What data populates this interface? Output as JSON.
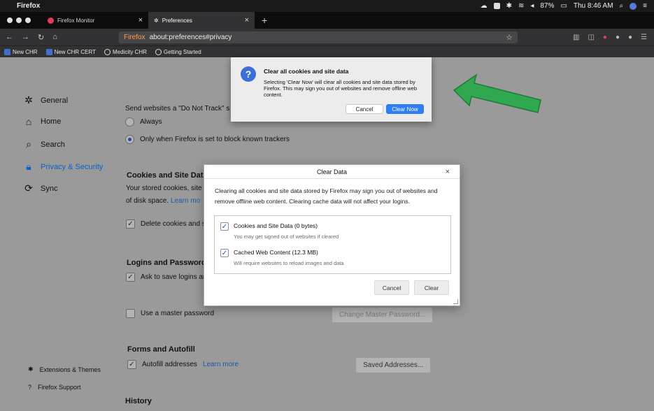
{
  "menubar": {
    "app_name": "Firefox",
    "battery": "87%",
    "clock": "Thu 8:46 AM"
  },
  "tabs": [
    {
      "label": "Firefox Monitor",
      "close": "×"
    },
    {
      "label": "Preferences",
      "close": "×"
    }
  ],
  "newtab": "+",
  "navbar": {
    "identity": "Firefox",
    "url": "about:preferences#privacy"
  },
  "bookmarks": [
    "New CHR",
    "New CHR CERT",
    "Medicity CHR",
    "Getting Started"
  ],
  "sidebar": {
    "items": [
      {
        "label": "General",
        "icon": "gear-icon"
      },
      {
        "label": "Home",
        "icon": "home-icon"
      },
      {
        "label": "Search",
        "icon": "search-icon"
      },
      {
        "label": "Privacy & Security",
        "icon": "lock-icon"
      },
      {
        "label": "Sync",
        "icon": "sync-icon"
      }
    ],
    "bottom": [
      {
        "label": "Extensions & Themes",
        "icon": "puzzle-icon"
      },
      {
        "label": "Firefox Support",
        "icon": "help-icon"
      }
    ]
  },
  "prefs": {
    "dnt_text": "Send websites a \"Do Not Track\" s",
    "dnt_always": "Always",
    "dnt_only": "Only when Firefox is set to block known trackers",
    "cookies_heading": "Cookies and Site Dat",
    "cookies_text_1": "Your stored cookies, site",
    "cookies_text_2": "of disk space.",
    "cookies_learn": "Learn mo",
    "delete_cookies": "Delete cookies and s",
    "logins_heading": "Logins and Password",
    "ask_save": "Ask to save logins ar",
    "master_password": "Use a master password",
    "change_master": "Change Master Password...",
    "forms_heading": "Forms and Autofill",
    "autofill": "Autofill addresses",
    "autofill_learn": "Learn more",
    "saved_addresses": "Saved Addresses...",
    "history_heading": "History"
  },
  "clear_dialog": {
    "title": "Clear Data",
    "close": "×",
    "text": "Clearing all cookies and site data stored by Firefox may sign you out of websites and remove offline web content. Clearing cache data will not affect your logins.",
    "options": [
      {
        "title": "Cookies and Site Data (0 bytes)",
        "subtitle": "You may get signed out of websites if cleared",
        "checked": true
      },
      {
        "title": "Cached Web Content (12.3 MB)",
        "subtitle": "Will require websites to reload images and data",
        "checked": true
      }
    ],
    "cancel": "Cancel",
    "clear": "Clear"
  },
  "alert": {
    "icon": "?",
    "title": "Clear all cookies and site data",
    "message": "Selecting 'Clear Now' will clear all cookies and site data stored by Firefox. This may sign you out of websites and remove offline web content.",
    "cancel": "Cancel",
    "confirm": "Clear Now"
  },
  "colors": {
    "arrow": "#2fa84f",
    "accent": "#2f7df4"
  }
}
